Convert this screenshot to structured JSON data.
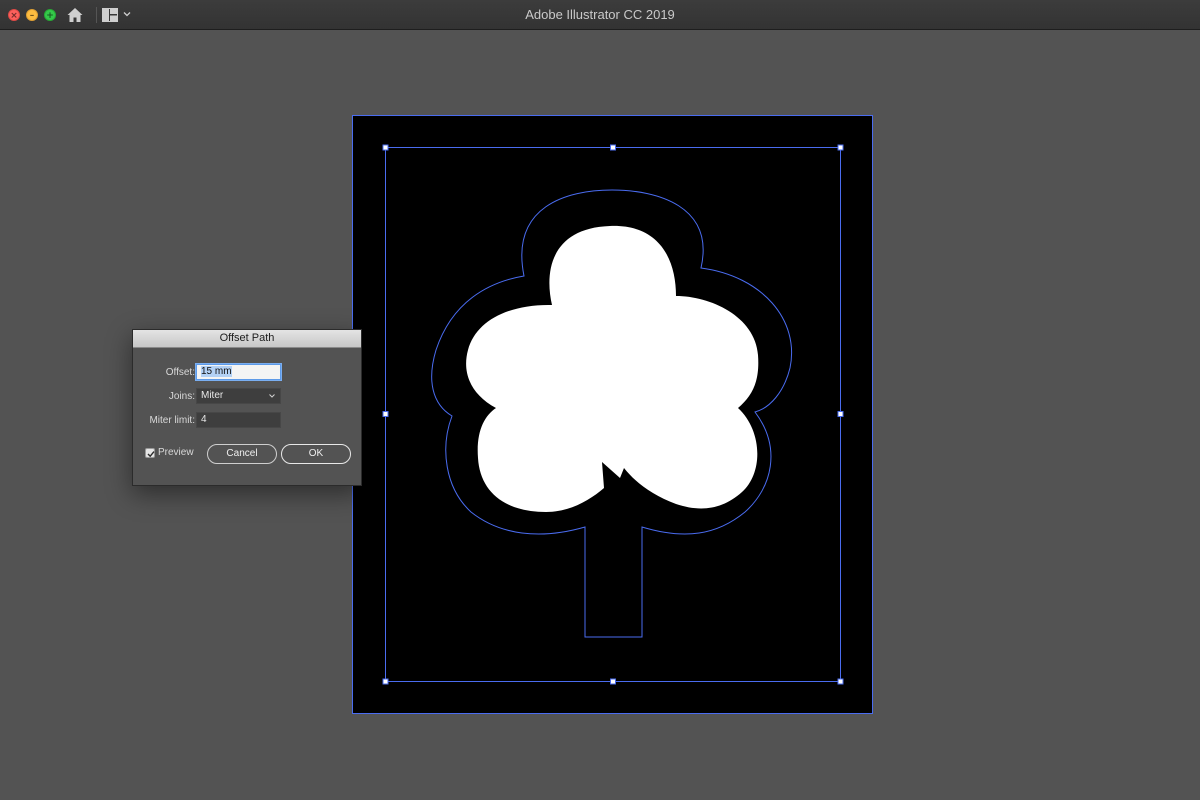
{
  "window": {
    "title": "Adobe Illustrator CC 2019",
    "icons": [
      "close-icon",
      "minimize-icon",
      "maximize-icon",
      "home-icon",
      "workspace-layout-icon",
      "chevron-down-icon"
    ]
  },
  "colors": {
    "app_background": "#535353",
    "artboard": "#000000",
    "selection": "#4a6cf0",
    "shape_fill": "#ffffff"
  },
  "dialog": {
    "title": "Offset Path",
    "offset_label": "Offset:",
    "offset_value": "15 mm",
    "joins_label": "Joins:",
    "joins_value": "Miter",
    "miter_label": "Miter limit:",
    "miter_value": "4",
    "preview_label": "Preview",
    "preview_checked": true,
    "cancel_label": "Cancel",
    "ok_label": "OK"
  }
}
